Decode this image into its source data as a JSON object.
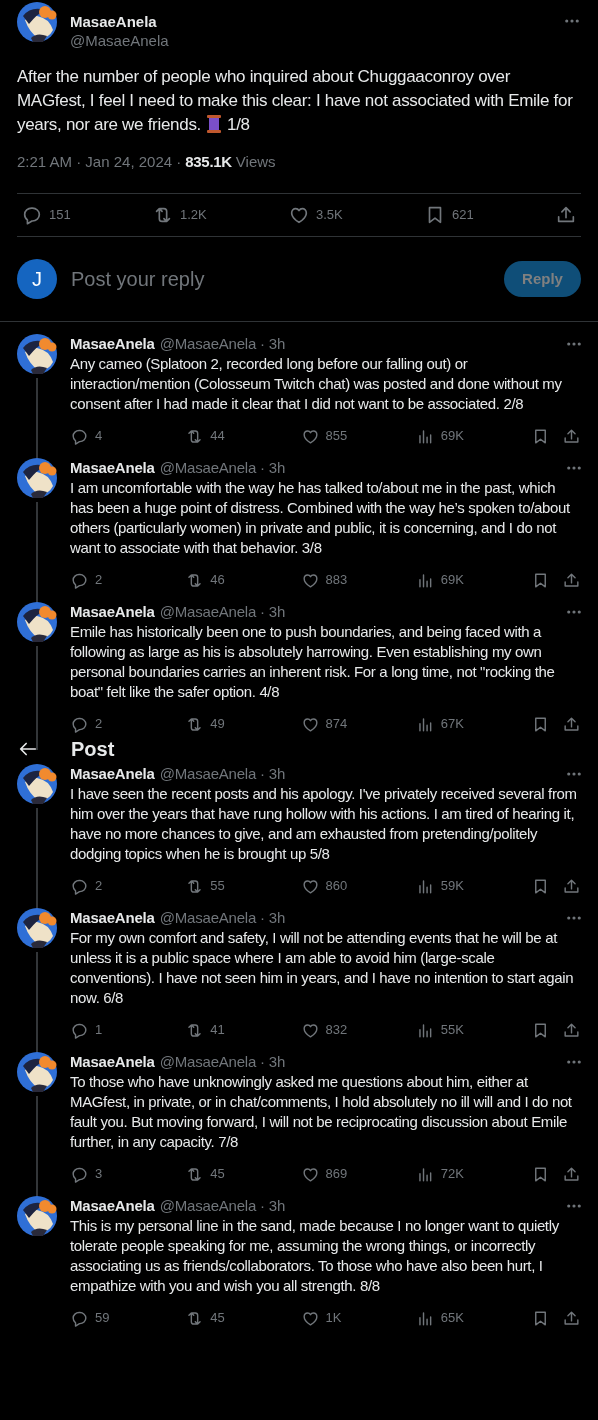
{
  "main_post": {
    "author_name": "MasaeAnela",
    "handle": "@MasaeAnela",
    "text": "After the number of people who inquired about Chuggaaconroy over MAGfest, I feel I need to make this clear: I have not associated with Emile for years, nor are we friends.",
    "thread_counter": "1/8",
    "timestamp": "2:21 AM · Jan 24, 2024 ·",
    "views": "835.1K",
    "views_label": "Views",
    "actions": [
      {
        "kind": "reply",
        "count": "151"
      },
      {
        "kind": "repost",
        "count": "1.2K"
      },
      {
        "kind": "like",
        "count": "3.5K"
      },
      {
        "kind": "bookmark",
        "count": "621"
      },
      {
        "kind": "share"
      }
    ]
  },
  "reply_composer": {
    "avatar_letter": "J",
    "placeholder": "Post your reply",
    "button": {
      "label": "Reply",
      "disabled": true
    }
  },
  "thread": [
    {
      "author_name": "MasaeAnela",
      "handle_time": "@MasaeAnela · 3h",
      "text": "Any cameo (Splatoon 2, recorded long before our falling out) or interaction/mention (Colosseum Twitch chat) was posted and done without my consent after I had made it clear that I did not want to be associated. 2/8",
      "actions": [
        {
          "kind": "reply",
          "count": "4"
        },
        {
          "kind": "repost",
          "count": "44"
        },
        {
          "kind": "like",
          "count": "855"
        },
        {
          "kind": "views",
          "count": "69K"
        },
        {
          "kind": "bookmark"
        },
        {
          "kind": "share"
        }
      ]
    },
    {
      "author_name": "MasaeAnela",
      "handle_time": "@MasaeAnela · 3h",
      "text": "I am uncomfortable with the way he has talked to/about me in the past, which has been a huge point of distress. Combined with the way he’s spoken to/about others (particularly women) in private and public, it is concerning, and I do not want to associate with that behavior. 3/8",
      "actions": [
        {
          "kind": "reply",
          "count": "2"
        },
        {
          "kind": "repost",
          "count": "46"
        },
        {
          "kind": "like",
          "count": "883"
        },
        {
          "kind": "views",
          "count": "69K"
        },
        {
          "kind": "bookmark"
        },
        {
          "kind": "share"
        }
      ]
    },
    {
      "author_name": "MasaeAnela",
      "handle_time": "@MasaeAnela · 3h",
      "text": "Emile has historically been one to push boundaries, and being faced with a following as large as his is absolutely harrowing. Even establishing my own personal boundaries carries an inherent risk. For a long time, not \"rocking the boat\" felt like the safer option. 4/8",
      "actions": [
        {
          "kind": "reply",
          "count": "2"
        },
        {
          "kind": "repost",
          "count": "49"
        },
        {
          "kind": "like",
          "count": "874"
        },
        {
          "kind": "views",
          "count": "67K"
        },
        {
          "kind": "bookmark"
        },
        {
          "kind": "share"
        }
      ]
    },
    {
      "author_name": "MasaeAnela",
      "handle_time": "@MasaeAnela · 3h",
      "text": "I have seen the recent posts and his apology. I've privately received several from him over the years that have rung hollow with his actions. I am tired of hearing it, have no more chances to give, and am exhausted from pretending/politely dodging topics when he is brought up 5/8",
      "actions": [
        {
          "kind": "reply",
          "count": "2"
        },
        {
          "kind": "repost",
          "count": "55"
        },
        {
          "kind": "like",
          "count": "860"
        },
        {
          "kind": "views",
          "count": "59K"
        },
        {
          "kind": "bookmark"
        },
        {
          "kind": "share"
        }
      ],
      "overlay_header": {
        "title": "Post"
      }
    },
    {
      "author_name": "MasaeAnela",
      "handle_time": "@MasaeAnela · 3h",
      "text": "For my own comfort and safety, I will not be attending events that he will be at unless it is a public space where I am able to avoid him (large-scale conventions). I have not seen him in years, and I have no intention to start again now. 6/8",
      "actions": [
        {
          "kind": "reply",
          "count": "1"
        },
        {
          "kind": "repost",
          "count": "41"
        },
        {
          "kind": "like",
          "count": "832"
        },
        {
          "kind": "views",
          "count": "55K"
        },
        {
          "kind": "bookmark"
        },
        {
          "kind": "share"
        }
      ]
    },
    {
      "author_name": "MasaeAnela",
      "handle_time": "@MasaeAnela · 3h",
      "text": "To those who have unknowingly asked me questions about him, either at MAGfest, in private, or in chat/comments, I hold absolutely no ill will and I do not fault you. But moving forward, I will not be reciprocating discussion about Emile further, in any capacity. 7/8",
      "actions": [
        {
          "kind": "reply",
          "count": "3"
        },
        {
          "kind": "repost",
          "count": "45"
        },
        {
          "kind": "like",
          "count": "869"
        },
        {
          "kind": "views",
          "count": "72K"
        },
        {
          "kind": "bookmark"
        },
        {
          "kind": "share"
        }
      ]
    },
    {
      "author_name": "MasaeAnela",
      "handle_time": "@MasaeAnela · 3h",
      "text": "This is my personal line in the sand, made because I no longer want to quietly tolerate people speaking for me, assuming the wrong things, or incorrectly associating us as friends/collaborators. To those who have also been hurt, I empathize with you and wish you all strength. 8/8",
      "actions": [
        {
          "kind": "reply",
          "count": "59"
        },
        {
          "kind": "repost",
          "count": "45"
        },
        {
          "kind": "like",
          "count": "1K"
        },
        {
          "kind": "views",
          "count": "65K"
        },
        {
          "kind": "bookmark"
        },
        {
          "kind": "share"
        }
      ]
    }
  ]
}
